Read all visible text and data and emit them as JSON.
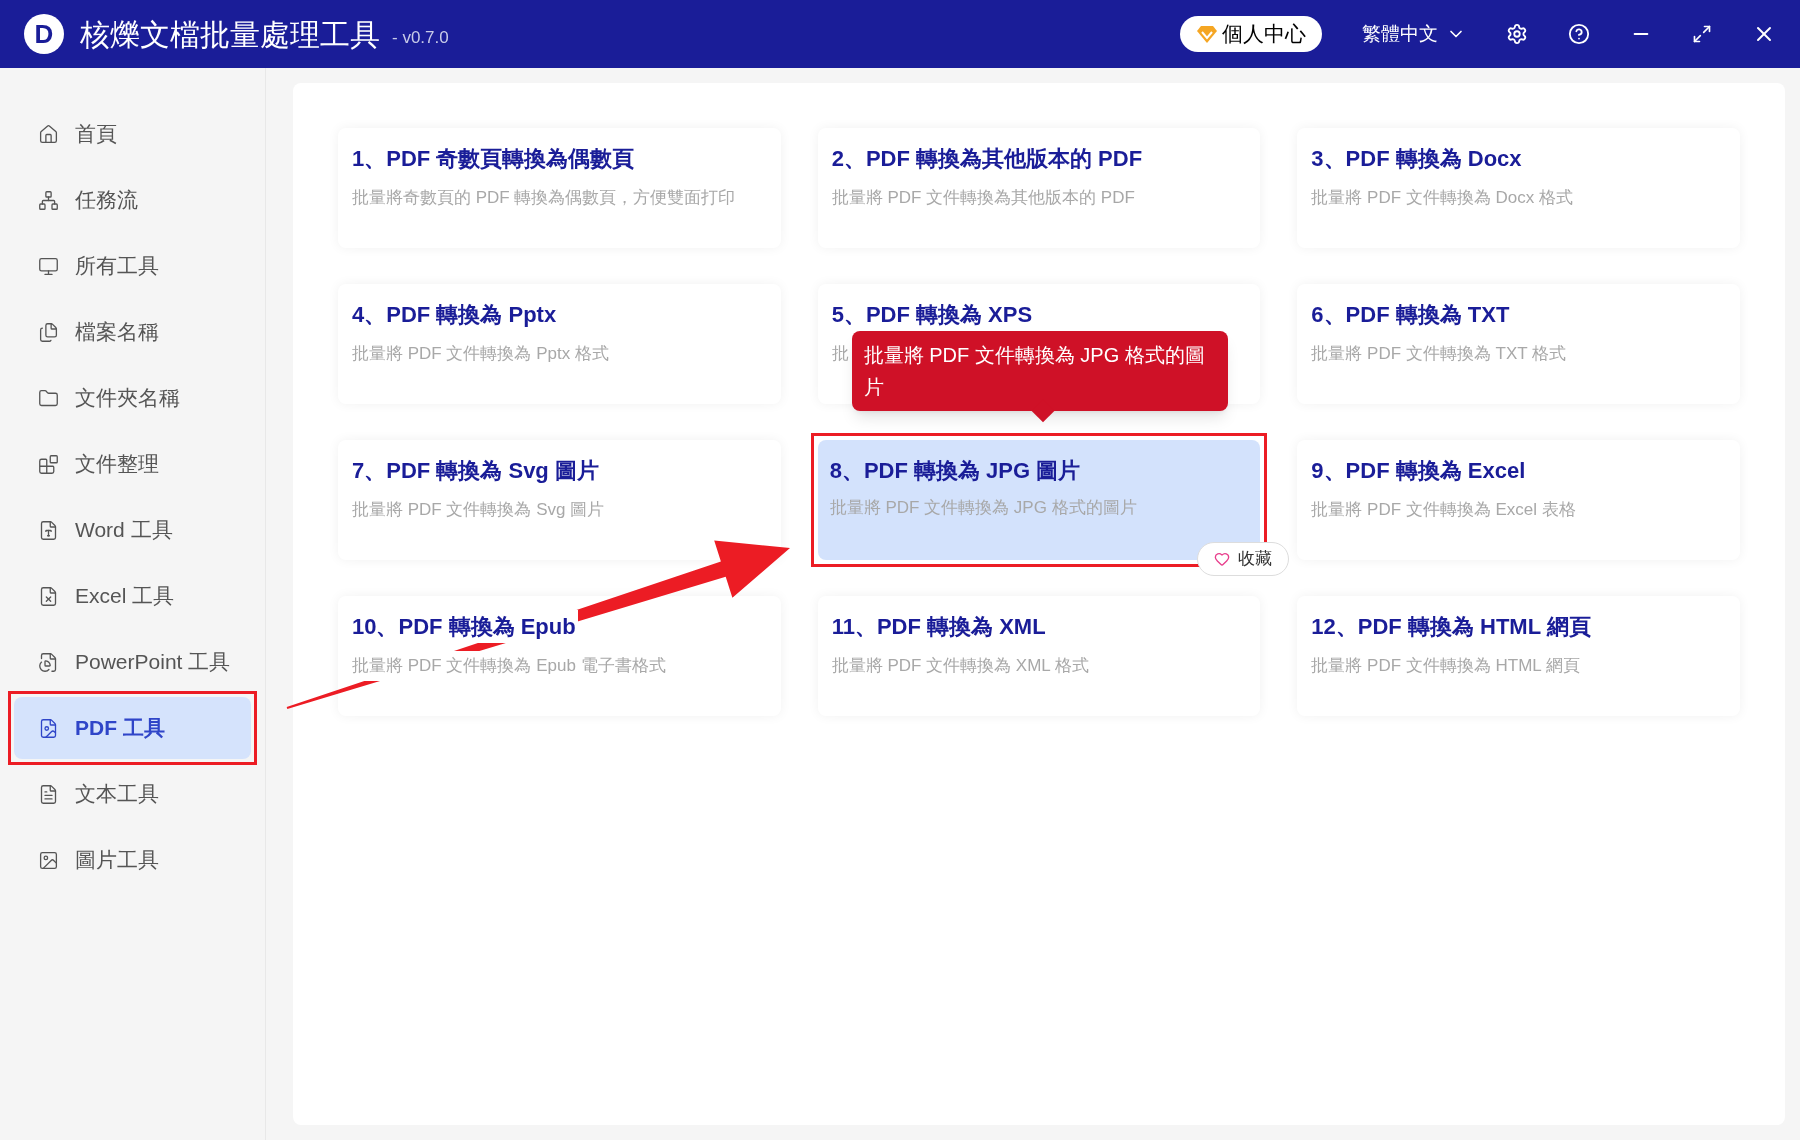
{
  "app": {
    "logo_letter": "D",
    "title": "核爍文檔批量處理工具",
    "version": "- v0.7.0"
  },
  "account_button": {
    "label": "個人中心"
  },
  "language": {
    "label": "繁體中文"
  },
  "sidebar": {
    "items": [
      {
        "label": "首頁",
        "selected": false
      },
      {
        "label": "任務流",
        "selected": false
      },
      {
        "label": "所有工具",
        "selected": false
      },
      {
        "label": "檔案名稱",
        "selected": false
      },
      {
        "label": "文件夾名稱",
        "selected": false
      },
      {
        "label": "文件整理",
        "selected": false
      },
      {
        "label": "Word 工具",
        "selected": false
      },
      {
        "label": "Excel 工具",
        "selected": false
      },
      {
        "label": "PowerPoint 工具",
        "selected": false
      },
      {
        "label": "PDF 工具",
        "selected": true
      },
      {
        "label": "文本工具",
        "selected": false
      },
      {
        "label": "圖片工具",
        "selected": false
      }
    ]
  },
  "tools": [
    {
      "title": "1、PDF 奇數頁轉換為偶數頁",
      "description": "批量將奇數頁的 PDF 轉換為偶數頁，方便雙面打印",
      "selected": false
    },
    {
      "title": "2、PDF 轉換為其他版本的 PDF",
      "description": "批量將 PDF 文件轉換為其他版本的 PDF",
      "selected": false
    },
    {
      "title": "3、PDF 轉換為 Docx",
      "description": "批量將 PDF 文件轉換為 Docx 格式",
      "selected": false
    },
    {
      "title": "4、PDF 轉換為 Pptx",
      "description": "批量將 PDF 文件轉換為 Pptx 格式",
      "selected": false
    },
    {
      "title": "5、PDF 轉換為 XPS",
      "description": "批",
      "selected": false
    },
    {
      "title": "6、PDF 轉換為 TXT",
      "description": "批量將 PDF 文件轉換為 TXT 格式",
      "selected": false
    },
    {
      "title": "7、PDF 轉換為 Svg 圖片",
      "description": "批量將 PDF 文件轉換為 Svg 圖片",
      "selected": false
    },
    {
      "title": "8、PDF 轉換為 JPG 圖片",
      "description": "批量將 PDF 文件轉換為 JPG 格式的圖片",
      "selected": true,
      "tooltip": "批量將 PDF 文件轉換為 JPG 格式的圖片",
      "favorite_label": "收藏"
    },
    {
      "title": "9、PDF 轉換為 Excel",
      "description": "批量將 PDF 文件轉換為 Excel 表格",
      "selected": false
    },
    {
      "title": "10、PDF 轉換為 Epub",
      "description": "批量將 PDF 文件轉換為 Epub 電子書格式",
      "selected": false
    },
    {
      "title": "11、PDF 轉換為 XML",
      "description": "批量將 PDF 文件轉換為 XML 格式",
      "selected": false
    },
    {
      "title": "12、PDF 轉換為 HTML 網頁",
      "description": "批量將 PDF 文件轉換為 HTML 網頁",
      "selected": false
    }
  ]
}
